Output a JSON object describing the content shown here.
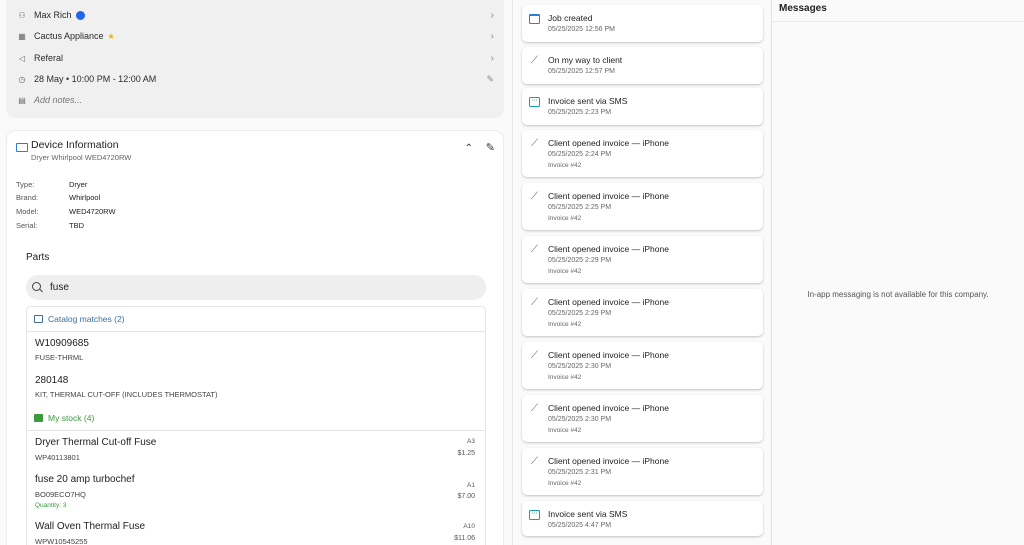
{
  "client": {
    "name": "Max Rich",
    "company": "Cactus Appliance",
    "source": "Referal",
    "schedule": "28 May • 10:00 PM - 12:00 AM",
    "notes_placeholder": "Add notes..."
  },
  "device": {
    "title": "Device Information",
    "subtitle": "Dryer Whirlpool WED4720RW",
    "specs": [
      {
        "label": "Type:",
        "value": "Dryer"
      },
      {
        "label": "Brand:",
        "value": "Whirlpool"
      },
      {
        "label": "Model:",
        "value": "WED4720RW"
      },
      {
        "label": "Serial:",
        "value": "TBD"
      }
    ]
  },
  "parts": {
    "label": "Parts",
    "search_value": "fuse",
    "catalog_header": "Catalog matches (2)",
    "catalog": [
      {
        "name": "W10909685",
        "code": "FUSE-THRML"
      },
      {
        "name": "280148",
        "code": "KIT, THERMAL CUT-OFF (INCLUDES THERMOSTAT)"
      }
    ],
    "stock_header": "My stock (4)",
    "stock": [
      {
        "name": "Dryer Thermal Cut-off Fuse",
        "code": "WP40113801",
        "loc": "A3",
        "price": "$1.25",
        "qty": ""
      },
      {
        "name": "fuse 20 amp turbochef",
        "code": "BO09ECO7HQ",
        "loc": "A1",
        "price": "$7.00",
        "qty": "Quantity: 3"
      },
      {
        "name": "Wall Oven Thermal Fuse",
        "code": "WPW10545255",
        "loc": "A10",
        "price": "$11.06",
        "qty": ""
      }
    ]
  },
  "timeline": [
    {
      "type": "calendar",
      "title": "Job created",
      "time": "05/25/2025 12:56 PM",
      "invoice": ""
    },
    {
      "type": "trend",
      "title": "On my way to client",
      "time": "05/25/2025 12:57 PM",
      "invoice": ""
    },
    {
      "type": "sms",
      "title": "Invoice sent via SMS",
      "time": "05/25/2025 2:23 PM",
      "invoice": ""
    },
    {
      "type": "trend",
      "title": "Client opened invoice — iPhone",
      "time": "05/25/2025 2:24 PM",
      "invoice": "Invoice #42"
    },
    {
      "type": "trend",
      "title": "Client opened invoice — iPhone",
      "time": "05/25/2025 2:25 PM",
      "invoice": "Invoice #42"
    },
    {
      "type": "trend",
      "title": "Client opened invoice — iPhone",
      "time": "05/25/2025 2:29 PM",
      "invoice": "Invoice #42"
    },
    {
      "type": "trend",
      "title": "Client opened invoice — iPhone",
      "time": "05/25/2025 2:29 PM",
      "invoice": "Invoice #42"
    },
    {
      "type": "trend",
      "title": "Client opened invoice — iPhone",
      "time": "05/25/2025 2:30 PM",
      "invoice": "Invoice #42"
    },
    {
      "type": "trend",
      "title": "Client opened invoice — iPhone",
      "time": "05/25/2025 2:30 PM",
      "invoice": "Invoice #42"
    },
    {
      "type": "trend",
      "title": "Client opened invoice — iPhone",
      "time": "05/25/2025 2:31 PM",
      "invoice": "Invoice #42"
    },
    {
      "type": "sms",
      "title": "Invoice sent via SMS",
      "time": "05/25/2025 4:47 PM",
      "invoice": ""
    }
  ],
  "messages": {
    "title": "Messages",
    "empty_text": "In-app messaging is not available for this company."
  },
  "colors": {
    "accent_blue": "#2a7fd4",
    "stock_green": "#3c9a3c",
    "sms_teal": "#19a0a0",
    "verified_dot": "#2563eb",
    "star": "#f2b400"
  }
}
